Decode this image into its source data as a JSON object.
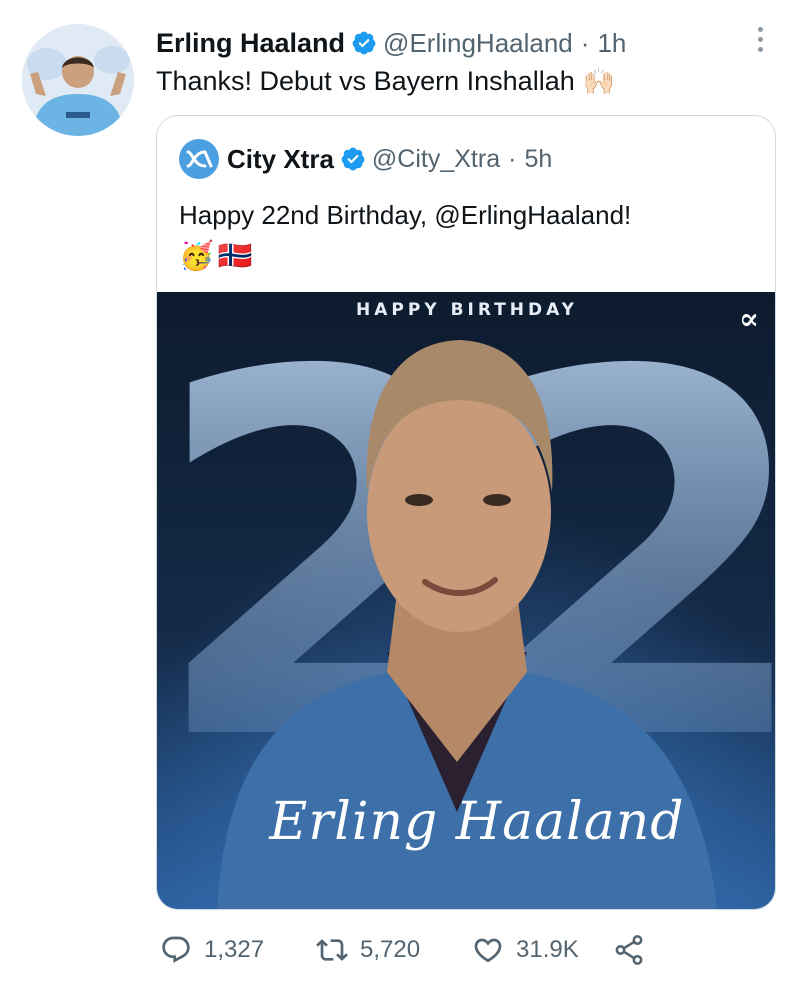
{
  "tweet": {
    "author_name": "Erling Haaland",
    "author_handle": "@ErlingHaaland",
    "separator": "·",
    "time": "1h",
    "text": "Thanks! Debut vs Bayern Inshallah",
    "emoji": "🙌🏻"
  },
  "quoted_tweet": {
    "author_name": "City Xtra",
    "author_handle": "@City_Xtra",
    "separator": "·",
    "time": "5h",
    "text": "Happy 22nd Birthday, @ErlingHaaland!",
    "emoji_party": "🥳",
    "emoji_flag": "🇳🇴",
    "image": {
      "headline": "HAPPY BIRTHDAY",
      "number": "22",
      "brand_mark": "∝",
      "signature": "Erling Haaland"
    }
  },
  "actions": {
    "replies": "1,327",
    "retweets": "5,720",
    "likes": "31.9K"
  },
  "icons": {
    "verified": "verified-badge-icon",
    "reply": "reply-icon",
    "retweet": "retweet-icon",
    "like": "heart-icon",
    "share": "share-icon",
    "more": "more-icon"
  },
  "colors": {
    "verified": "#1d9bf0",
    "secondary_text": "#536471",
    "card_border": "#cfd9de",
    "city_xtra_logo": "#4a9fe0"
  }
}
